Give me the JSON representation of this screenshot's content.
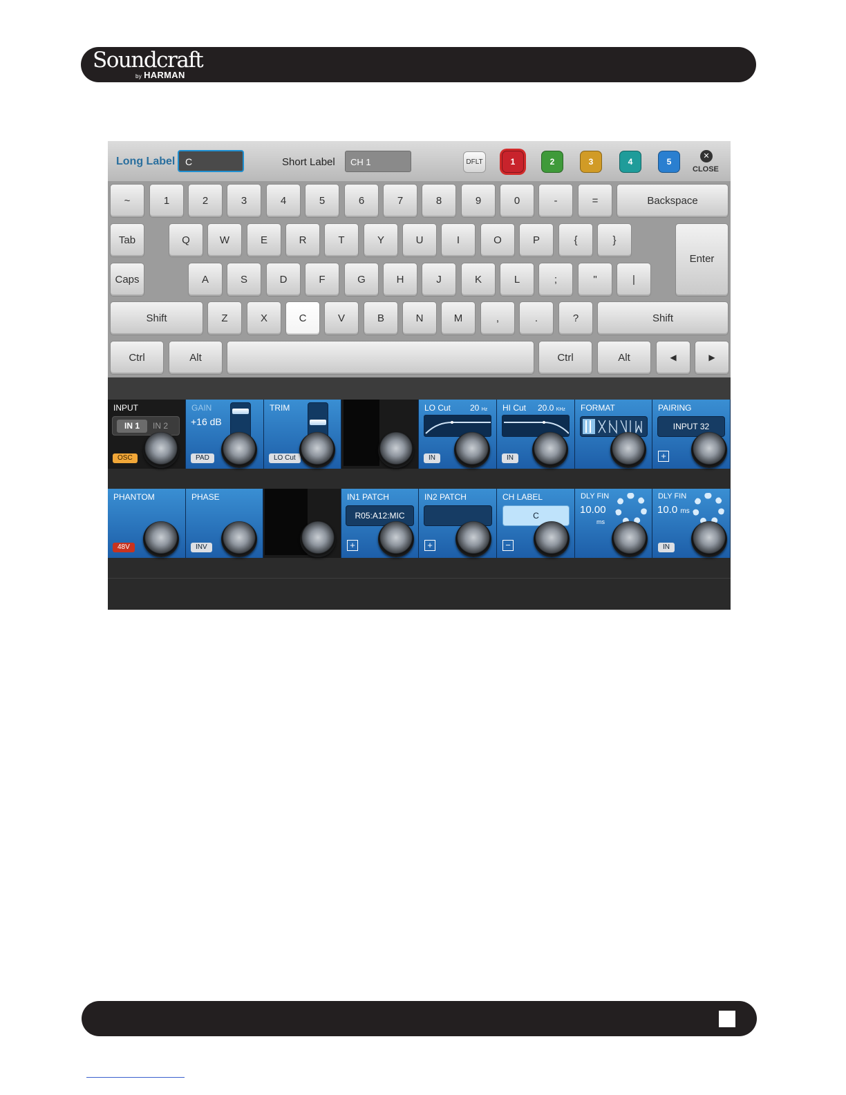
{
  "header": {
    "brand": "Soundcraft",
    "brand_sub_prefix": "by",
    "brand_sub": "HARMAN"
  },
  "label_row": {
    "long_label_text": "Long Label",
    "long_label_value": "C",
    "short_label_text": "Short Label",
    "short_label_value": "CH 1",
    "dflt_label": "DFLT",
    "color_buttons": [
      {
        "label": "1",
        "color": "#c8232c"
      },
      {
        "label": "2",
        "color": "#3f9a3a"
      },
      {
        "label": "3",
        "color": "#d19b26"
      },
      {
        "label": "4",
        "color": "#1f9c9a"
      },
      {
        "label": "5",
        "color": "#2a7fd0"
      }
    ],
    "close_label": "CLOSE"
  },
  "keyboard": {
    "row1": [
      "~",
      "1",
      "2",
      "3",
      "4",
      "5",
      "6",
      "7",
      "8",
      "9",
      "0",
      "-",
      "="
    ],
    "backspace": "Backspace",
    "tab": "Tab",
    "row2": [
      "Q",
      "W",
      "E",
      "R",
      "T",
      "Y",
      "U",
      "I",
      "O",
      "P",
      "{",
      "}"
    ],
    "enter": "Enter",
    "caps": "Caps",
    "row3": [
      "A",
      "S",
      "D",
      "F",
      "G",
      "H",
      "J",
      "K",
      "L",
      ";",
      "\"",
      "|"
    ],
    "shift": "Shift",
    "row4": [
      "Z",
      "X",
      "C",
      "V",
      "B",
      "N",
      "M",
      ",",
      ".",
      "?"
    ],
    "ctrl": "Ctrl",
    "alt": "Alt",
    "arrow_left": "◀",
    "arrow_right": "▶"
  },
  "panels": {
    "input": {
      "title": "INPUT",
      "in1": "IN 1",
      "in2": "IN 2",
      "button": "OSC"
    },
    "gain": {
      "title": "GAIN",
      "value": "+16 dB",
      "button": "PAD"
    },
    "trim": {
      "title": "TRIM",
      "button": "LO Cut"
    },
    "lo_cut": {
      "title": "LO Cut",
      "value": "20",
      "unit": "Hz",
      "button": "IN"
    },
    "hi_cut": {
      "title": "HI Cut",
      "value": "20.0",
      "unit": "KHz",
      "button": "IN"
    },
    "format": {
      "title": "FORMAT"
    },
    "pairing": {
      "title": "PAIRING",
      "value": "INPUT 32"
    },
    "phantom": {
      "title": "PHANTOM",
      "button": "48V"
    },
    "phase": {
      "title": "PHASE",
      "button": "INV"
    },
    "in1_patch": {
      "title": "IN1 PATCH",
      "value": "R05:A12:MIC"
    },
    "in2_patch": {
      "title": "IN2 PATCH",
      "value": ""
    },
    "ch_label": {
      "title": "CH LABEL",
      "value": "C"
    },
    "dly_fin_1": {
      "title": "DLY FIN",
      "value": "10.00",
      "unit": "ms"
    },
    "dly_fin_2": {
      "title": "DLY FIN",
      "value": "10.0",
      "unit": "ms",
      "button": "IN"
    }
  }
}
